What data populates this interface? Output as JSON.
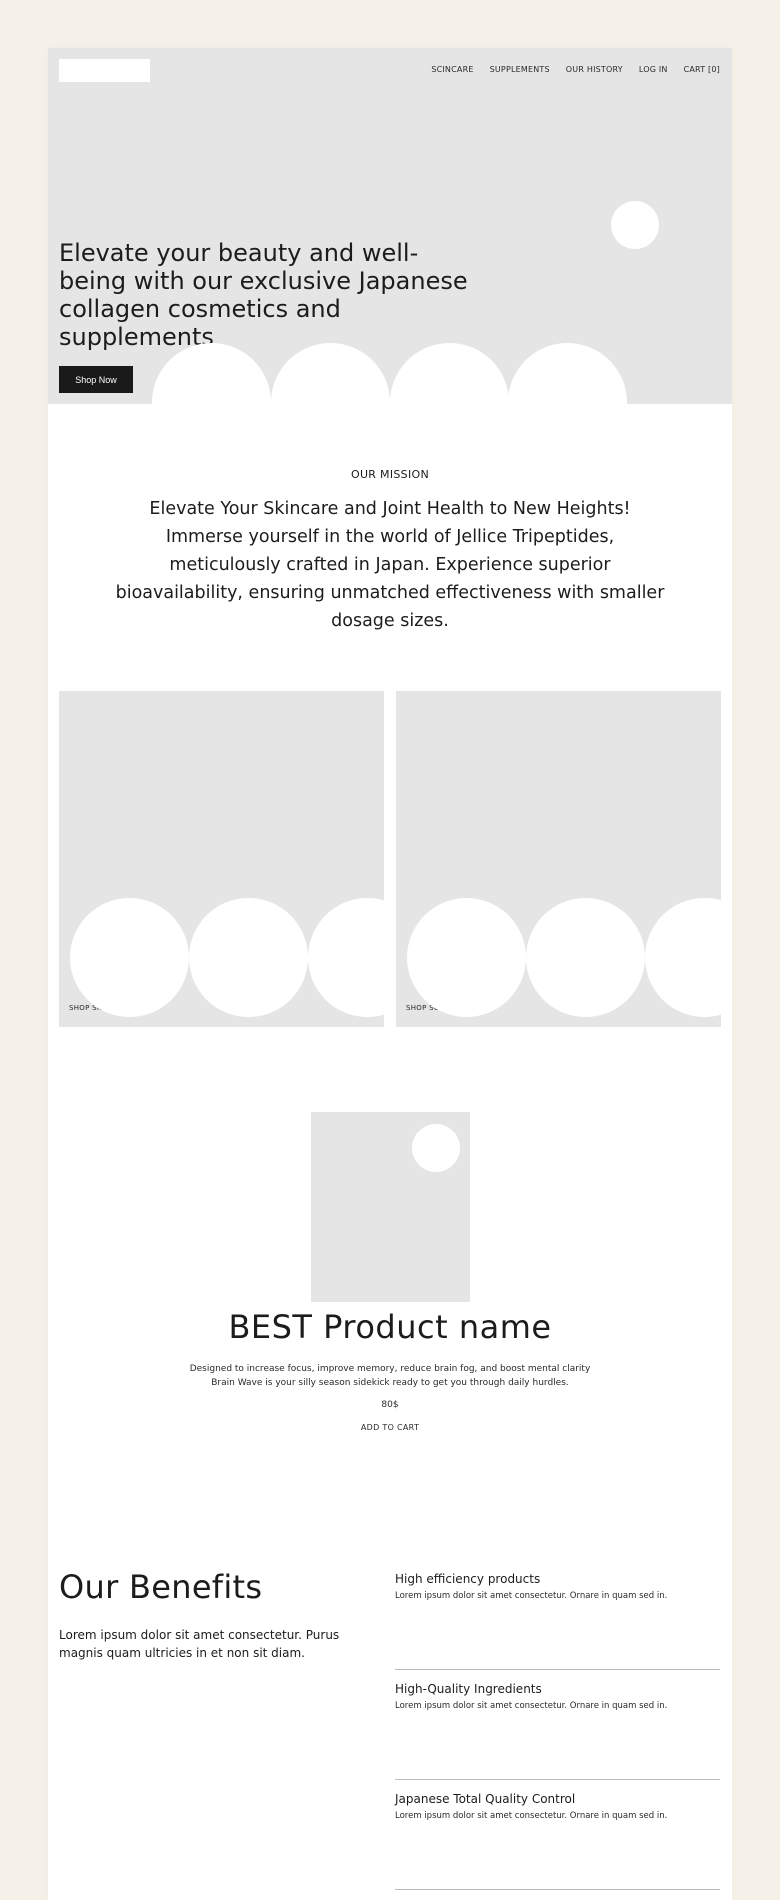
{
  "nav": {
    "items": [
      {
        "label": "SCINCARE"
      },
      {
        "label": "SUPPLEMENTS"
      },
      {
        "label": "OUR HISTORY"
      },
      {
        "label": "LOG IN"
      },
      {
        "label": "CART [0]"
      }
    ]
  },
  "hero": {
    "title": "Elevate your beauty and well-being with our exclusive Japanese collagen cosmetics and supplements",
    "button_label": "Shop Now"
  },
  "mission": {
    "label": "OUR MISSION",
    "text": "Elevate Your Skincare and Joint Health to New Heights! Immerse yourself in the world of Jellice Tripeptides, meticulously crafted in Japan. Experience superior bioavailability, ensuring unmatched effectiveness with smaller dosage sizes."
  },
  "categories": [
    {
      "label": "SHOP SKINCARE"
    },
    {
      "label": "SHOP SUPPLEMENTS"
    }
  ],
  "product": {
    "title": "BEST Product name",
    "description": "Designed to increase focus, improve memory, reduce brain fog, and boost mental clarity Brain Wave is your silly season sidekick ready to get you through daily hurdles.",
    "price": "80$",
    "add_to_cart": "ADD TO CART"
  },
  "benefits": {
    "title": "Our Benefits",
    "description": "Lorem ipsum dolor sit amet consectetur. Purus magnis quam ultricies in et non sit diam.",
    "items": [
      {
        "title": "High efficiency products",
        "text": "Lorem ipsum dolor sit amet consectetur. Ornare in quam sed in."
      },
      {
        "title": "High-Quality Ingredients",
        "text": "Lorem ipsum dolor sit amet consectetur. Ornare in quam sed in."
      },
      {
        "title": "Japanese Total Quality Control",
        "text": "Lorem ipsum dolor sit amet consectetur. Ornare in quam sed in."
      }
    ]
  },
  "colors": {
    "page_background": "#f5f1e8",
    "placeholder_gray": "#e5e5e5",
    "button_dark": "#1a1a1a"
  }
}
